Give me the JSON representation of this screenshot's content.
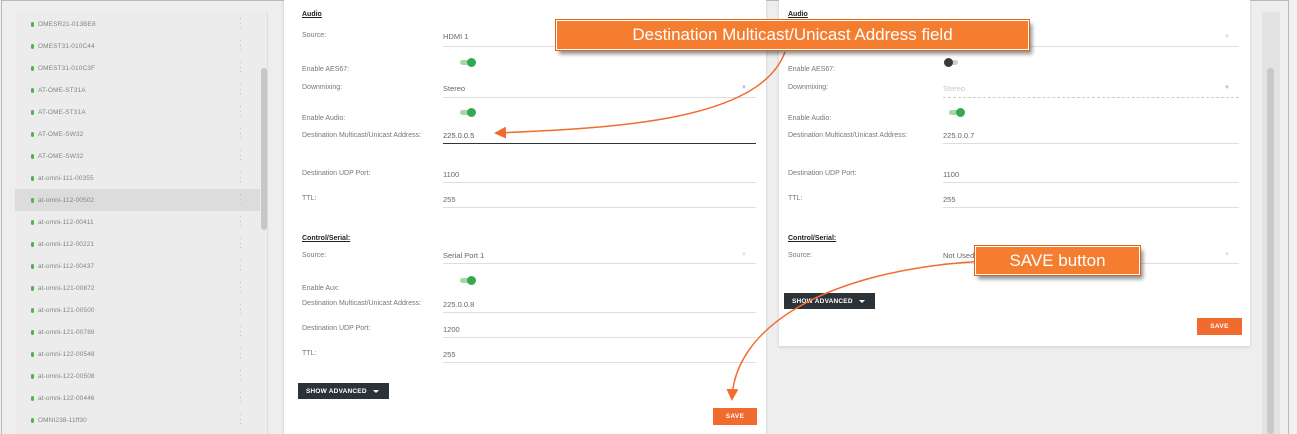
{
  "sidebar": {
    "devices": [
      {
        "name": "OMESR21-013BE8",
        "selected": false
      },
      {
        "name": "OMEST31-010C44",
        "selected": false
      },
      {
        "name": "OMEST31-010C3F",
        "selected": false
      },
      {
        "name": "AT-OME-ST31A",
        "selected": false
      },
      {
        "name": "AT-OME-ST31A",
        "selected": false
      },
      {
        "name": "AT-OME-SW32",
        "selected": false
      },
      {
        "name": "AT-OME-SW32",
        "selected": false
      },
      {
        "name": "at-omni-111-00355",
        "selected": false
      },
      {
        "name": "at-omni-112-00502",
        "selected": true
      },
      {
        "name": "at-omni-112-00411",
        "selected": false
      },
      {
        "name": "at-omni-112-00221",
        "selected": false
      },
      {
        "name": "at-omni-112-00437",
        "selected": false
      },
      {
        "name": "at-omni-121-00872",
        "selected": false
      },
      {
        "name": "at-omni-121-00500",
        "selected": false
      },
      {
        "name": "at-omni-121-00789",
        "selected": false
      },
      {
        "name": "at-omni-122-00548",
        "selected": false
      },
      {
        "name": "at-omni-122-00508",
        "selected": false
      },
      {
        "name": "at-omni-122-00446",
        "selected": false
      },
      {
        "name": "OMNI238-11ff30",
        "selected": false
      }
    ]
  },
  "panel1": {
    "audio_title": "Audio",
    "source_label": "Source:",
    "source_value": "HDMI 1",
    "aes67_label": "Enable AES67:",
    "downmix_label": "Downmixing:",
    "downmix_value": "Stereo",
    "enable_audio_label": "Enable Audio:",
    "dest_addr_label": "Destination Multicast/Unicast Address:",
    "dest_addr_value": "225.0.0.5",
    "udp_label": "Destination UDP Port:",
    "udp_value": "1100",
    "ttl_label": "TTL:",
    "ttl_value": "255",
    "control_title": "Control/Serial:",
    "ctrl_source_label": "Source:",
    "ctrl_source_value": "Serial Port 1",
    "aux_label": "Enable Aux:",
    "ctrl_dest_label": "Destination Multicast/Unicast Address:",
    "ctrl_dest_value": "225.0.0.8",
    "ctrl_udp_label": "Destination UDP Port:",
    "ctrl_udp_value": "1200",
    "ctrl_ttl_label": "TTL:",
    "ctrl_ttl_value": "255",
    "show_advanced": "SHOW ADVANCED",
    "save": "SAVE"
  },
  "panel2": {
    "audio_title": "Audio",
    "aes67_label": "Enable AES67:",
    "downmix_label": "Downmixing:",
    "downmix_value": "Stereo",
    "enable_audio_label": "Enable Audio:",
    "dest_addr_label": "Destination Multicast/Unicast Address:",
    "dest_addr_value": "225.0.0.7",
    "udp_label": "Destination UDP Port:",
    "udp_value": "1100",
    "ttl_label": "TTL:",
    "ttl_value": "255",
    "control_title": "Control/Serial:",
    "ctrl_source_label": "Source:",
    "ctrl_source_value": "Not Used",
    "show_advanced": "SHOW ADVANCED",
    "save": "SAVE"
  },
  "callouts": {
    "dest_field": "Destination Multicast/Unicast Address field",
    "save_button": "SAVE button"
  },
  "colors": {
    "accent": "#f26b2e",
    "toggle_on": "#34a853",
    "dark_button": "#2c3338"
  }
}
